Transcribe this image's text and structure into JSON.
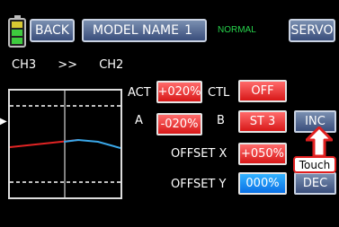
{
  "header": {
    "back_label": "BACK",
    "model_name": "MODEL NAME",
    "model_number": "1",
    "mode": "NORMAL",
    "servo_label": "SERVO"
  },
  "channel": {
    "from": "CH3",
    "arrow": ">>",
    "to": "CH2"
  },
  "params": {
    "act_label": "ACT",
    "act_value": "+020%",
    "ctl_label": "CTL",
    "ctl_value": "OFF",
    "a_label": "A",
    "a_value": "-020%",
    "b_label": "B",
    "b_value": "ST 3",
    "offset_x_label": "OFFSET X",
    "offset_x_value": "+050%",
    "offset_y_label": "OFFSET Y",
    "offset_y_value": "000%"
  },
  "buttons": {
    "inc_label": "INC",
    "dec_label": "DEC"
  },
  "hint": {
    "touch_label": "Touch"
  },
  "colors": {
    "accent_red": "#d81818",
    "accent_blue": "#0a70e6",
    "status_green": "#26d24b"
  },
  "icons": {
    "battery": "battery-icon",
    "arrow": "arrow-up-icon"
  }
}
